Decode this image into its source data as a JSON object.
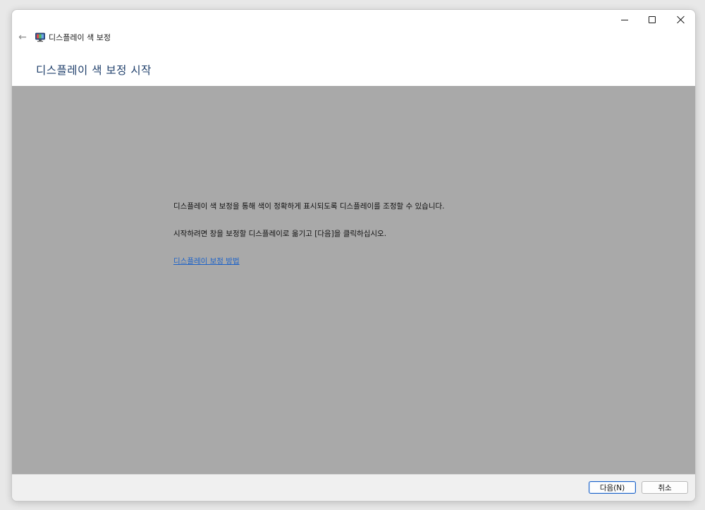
{
  "window": {
    "title": "디스플레이 색 보정",
    "controls": {
      "minimize": "minimize",
      "maximize": "maximize",
      "close": "close"
    }
  },
  "nav": {
    "back_icon": "back-arrow-icon",
    "app_icon": "display-monitor-icon"
  },
  "heading": "디스플레이 색 보정 시작",
  "content": {
    "paragraph1": "디스플레이 색 보정을 통해 색이 정확하게 표시되도록 디스플레이를 조정할 수 있습니다.",
    "paragraph2": "시작하려면 창을 보정할 디스플레이로 옮기고 [다음]을 클릭하십시오.",
    "help_link": "디스플레이 보정 방법"
  },
  "footer": {
    "next_label": "다음(N)",
    "cancel_label": "취소"
  },
  "colors": {
    "content_bg": "#a9a9a9",
    "heading": "#1f3f6b",
    "link": "#1e63c8"
  }
}
